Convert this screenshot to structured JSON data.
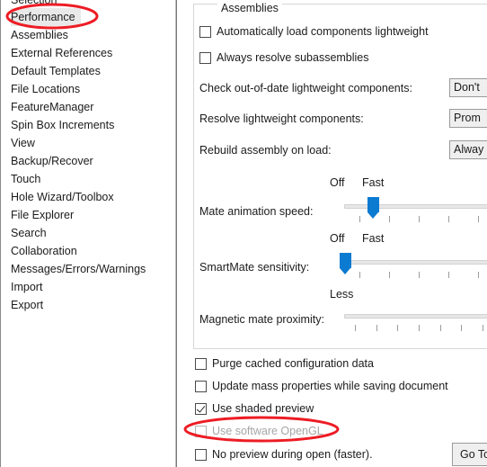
{
  "sidebar": {
    "items": [
      {
        "label": "Selection",
        "selected": false,
        "clipped": true
      },
      {
        "label": "Performance",
        "selected": true,
        "clipped": false
      },
      {
        "label": "Assemblies",
        "selected": false,
        "clipped": false
      },
      {
        "label": "External References",
        "selected": false,
        "clipped": false
      },
      {
        "label": "Default Templates",
        "selected": false,
        "clipped": false
      },
      {
        "label": "File Locations",
        "selected": false,
        "clipped": false
      },
      {
        "label": "FeatureManager",
        "selected": false,
        "clipped": false
      },
      {
        "label": "Spin Box Increments",
        "selected": false,
        "clipped": false
      },
      {
        "label": "View",
        "selected": false,
        "clipped": false
      },
      {
        "label": "Backup/Recover",
        "selected": false,
        "clipped": false
      },
      {
        "label": "Touch",
        "selected": false,
        "clipped": false
      },
      {
        "label": "Hole Wizard/Toolbox",
        "selected": false,
        "clipped": false
      },
      {
        "label": "File Explorer",
        "selected": false,
        "clipped": false
      },
      {
        "label": "Search",
        "selected": false,
        "clipped": false
      },
      {
        "label": "Collaboration",
        "selected": false,
        "clipped": false
      },
      {
        "label": "Messages/Errors/Warnings",
        "selected": false,
        "clipped": false
      },
      {
        "label": "Import",
        "selected": false,
        "clipped": false
      },
      {
        "label": "Export",
        "selected": false,
        "clipped": false
      }
    ]
  },
  "panel": {
    "group_title": "Assemblies",
    "checkboxes_top": [
      {
        "label": "Automatically load components lightweight",
        "checked": false,
        "disabled": false
      },
      {
        "label": "Always resolve subassemblies",
        "checked": false,
        "disabled": false
      }
    ],
    "fields": [
      {
        "label": "Check out-of-date lightweight components:",
        "value": "Don't"
      },
      {
        "label": "Resolve lightweight components:",
        "value": "Prom"
      },
      {
        "label": "Rebuild assembly on load:",
        "value": "Alway"
      }
    ],
    "sliders": [
      {
        "label": "Mate animation speed:",
        "cap_left": "Off",
        "cap_right": "Fast",
        "thumb_percent": 26,
        "ticks": 5
      },
      {
        "label": "SmartMate sensitivity:",
        "cap_left": "Off",
        "cap_right": "Fast",
        "thumb_percent": 0,
        "ticks": 5
      },
      {
        "label": "Magnetic mate proximity:",
        "cap_left": "Less",
        "cap_right": "",
        "thumb_percent": -1,
        "ticks": 7
      }
    ],
    "checkboxes_bottom": [
      {
        "label": "Purge cached configuration data",
        "checked": false,
        "disabled": false
      },
      {
        "label": "Update mass properties while saving document",
        "checked": false,
        "disabled": false
      },
      {
        "label": "Use shaded preview",
        "checked": true,
        "disabled": false
      },
      {
        "label": "Use software OpenGL",
        "checked": false,
        "disabled": true
      },
      {
        "label": "No preview during open (faster).",
        "checked": false,
        "disabled": false
      }
    ],
    "button": {
      "label": "Go To In"
    }
  },
  "annotations": {
    "accent_color": "#ED1C24",
    "ellipses": [
      {
        "target": "sidebar-item-performance"
      },
      {
        "target": "checkbox-use-software-opengl"
      }
    ]
  }
}
